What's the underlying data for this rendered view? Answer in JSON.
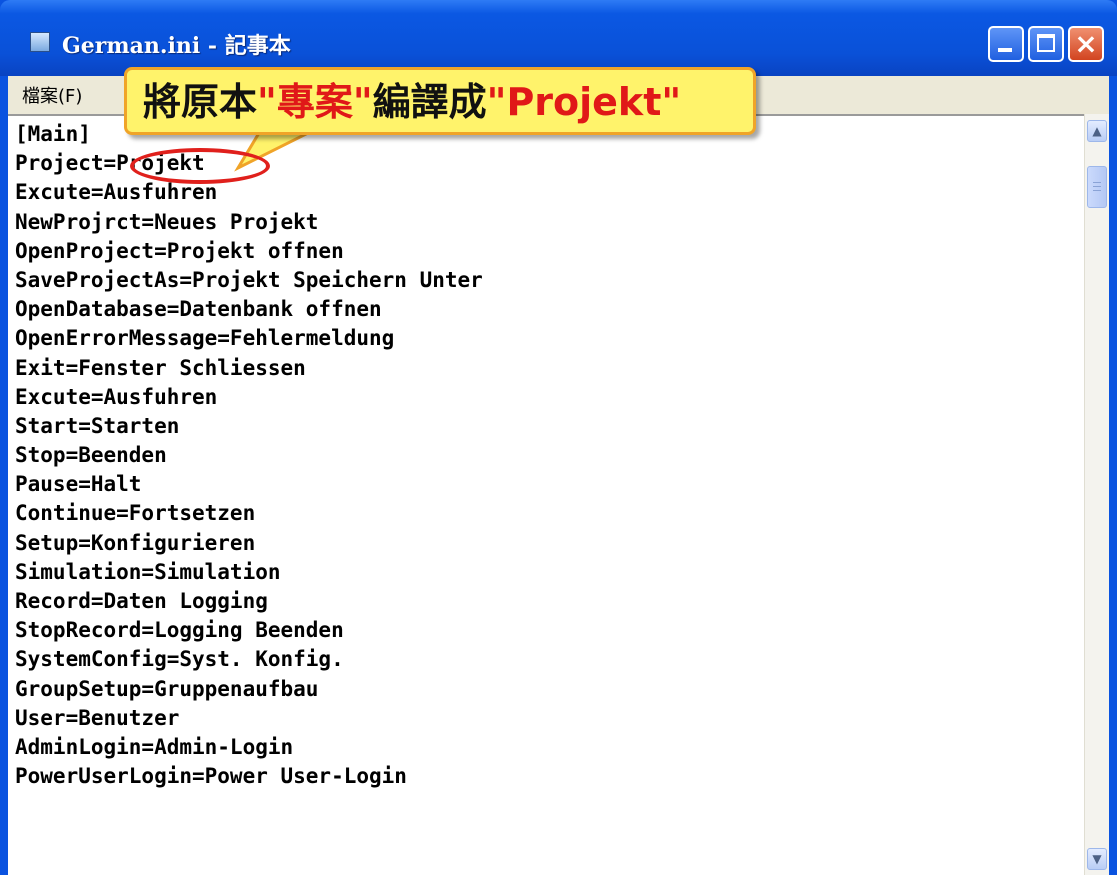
{
  "window": {
    "title": "German.ini - 記事本",
    "menu": [
      "檔案(F)"
    ]
  },
  "annotation": {
    "prefix": "將原本",
    "quoted_source": "\"專案\"",
    "middle": "編譯成",
    "quoted_target": "\"Projekt\""
  },
  "lines": [
    "[Main]",
    "Project=Projekt",
    "Excute=Ausfuhren",
    "NewProjrct=Neues Projekt",
    "OpenProject=Projekt offnen",
    "SaveProjectAs=Projekt Speichern Unter",
    "OpenDatabase=Datenbank offnen",
    "OpenErrorMessage=Fehlermeldung",
    "Exit=Fenster Schliessen",
    "Excute=Ausfuhren",
    "Start=Starten",
    "Stop=Beenden",
    "Pause=Halt",
    "Continue=Fortsetzen",
    "Setup=Konfigurieren",
    "Simulation=Simulation",
    "Record=Daten Logging",
    "StopRecord=Logging Beenden",
    "SystemConfig=Syst. Konfig.",
    "GroupSetup=Gruppenaufbau",
    "User=Benutzer",
    "AdminLogin=Admin-Login",
    "PowerUserLogin=Power User-Login"
  ],
  "colors": {
    "titlebar": "#0a51d8",
    "menubar": "#ece9d8",
    "callout_fill": "#fff36b",
    "callout_border": "#f0a428",
    "highlight": "#e0201c"
  }
}
